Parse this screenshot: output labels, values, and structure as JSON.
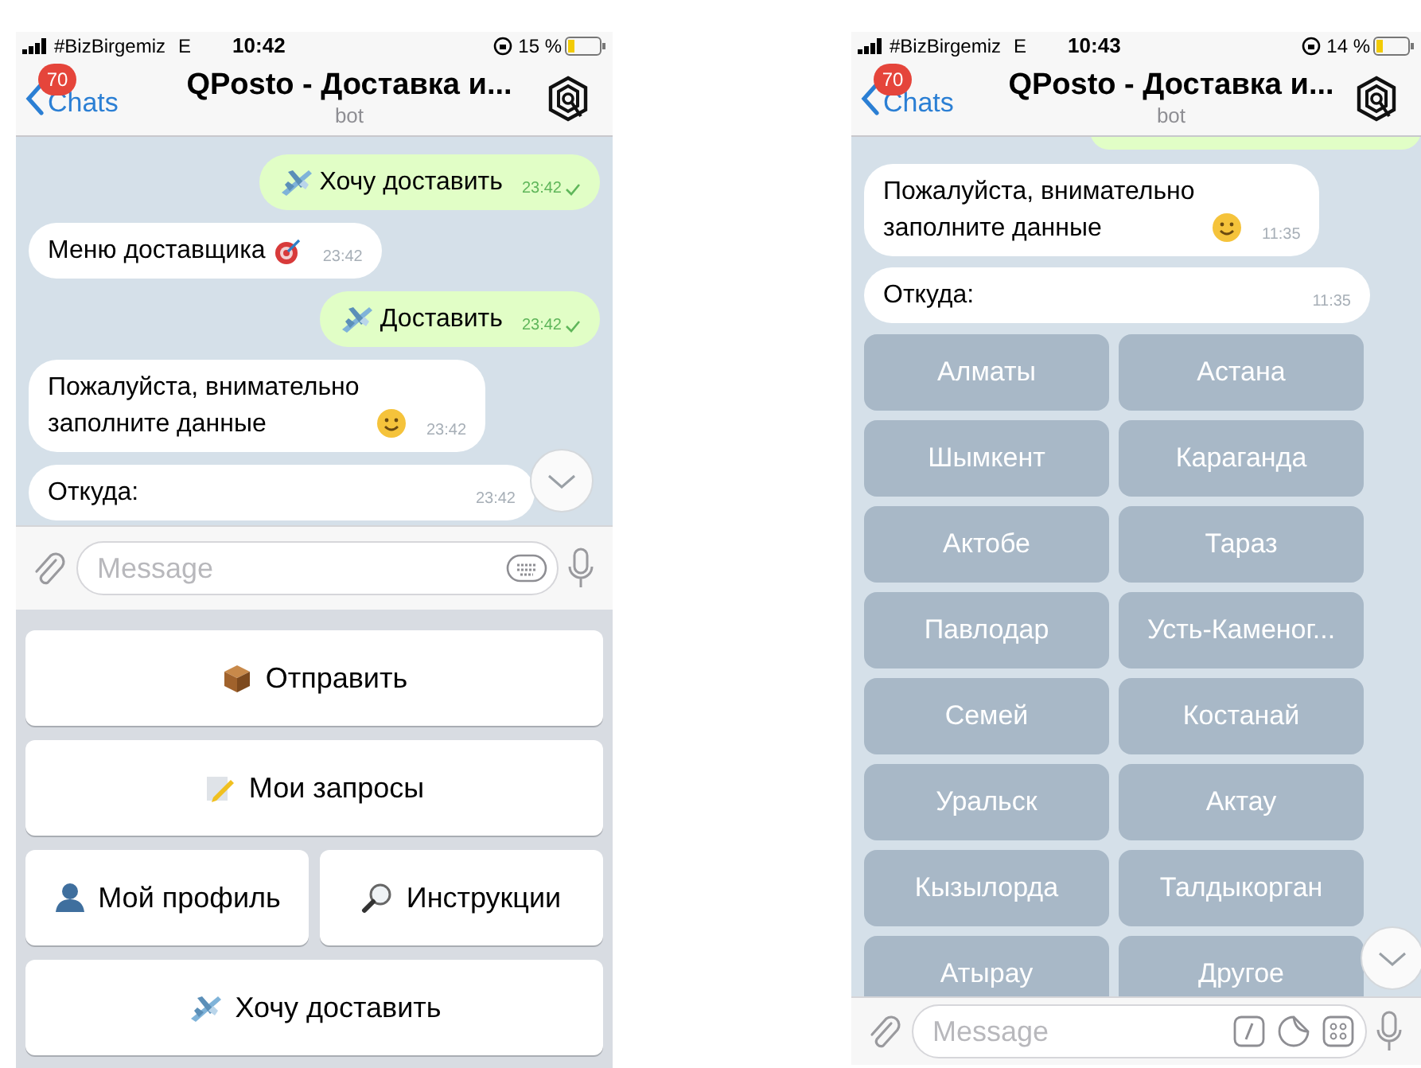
{
  "screens": [
    {
      "status_bar": {
        "carrier": "#BizBirgemiz",
        "network": "E",
        "time": "10:42",
        "battery": "15 %"
      },
      "header": {
        "back": "Chats",
        "badge": "70",
        "title": "QPosto - Доставка и...",
        "subtitle": "bot"
      },
      "messages": [
        {
          "text": "Хочу доставить",
          "time": "23:42",
          "outgoing": true
        },
        {
          "text": "Меню доставщика",
          "time": "23:42",
          "outgoing": false
        },
        {
          "text": "Доставить",
          "time": "23:42",
          "outgoing": true
        },
        {
          "text": "Пожалуйста, внимательно заполните данные",
          "time": "23:42",
          "outgoing": false
        },
        {
          "text": "Откуда:",
          "time": "23:42",
          "outgoing": false
        }
      ],
      "composer": {
        "placeholder": "Message"
      },
      "reply_keyboard": [
        [
          {
            "label": "Отправить"
          }
        ],
        [
          {
            "label": "Мои запросы"
          }
        ],
        [
          {
            "label": "Мой профиль"
          },
          {
            "label": "Инструкции"
          }
        ],
        [
          {
            "label": "Хочу доставить"
          }
        ]
      ]
    },
    {
      "status_bar": {
        "carrier": "#BizBirgemiz",
        "network": "E",
        "time": "10:43",
        "battery": "14 %"
      },
      "header": {
        "back": "Chats",
        "badge": "70",
        "title": "QPosto - Доставка и...",
        "subtitle": "bot"
      },
      "messages": [
        {
          "text": "Пожалуйста, внимательно заполните данные",
          "time": "11:35",
          "outgoing": false
        },
        {
          "text": "Откуда:",
          "time": "11:35",
          "outgoing": false
        }
      ],
      "inline_keyboard": [
        [
          {
            "label": "Алматы"
          },
          {
            "label": "Астана"
          }
        ],
        [
          {
            "label": "Шымкент"
          },
          {
            "label": "Караганда"
          }
        ],
        [
          {
            "label": "Актобе"
          },
          {
            "label": "Тараз"
          }
        ],
        [
          {
            "label": "Павлодар"
          },
          {
            "label": "Усть-Каменог..."
          }
        ],
        [
          {
            "label": "Семей"
          },
          {
            "label": "Костанай"
          }
        ],
        [
          {
            "label": "Уральск"
          },
          {
            "label": "Актау"
          }
        ],
        [
          {
            "label": "Кызылорда"
          },
          {
            "label": "Талдыкорган"
          }
        ],
        [
          {
            "label": "Атырау"
          },
          {
            "label": "Другое"
          }
        ]
      ],
      "composer": {
        "placeholder": "Message"
      }
    }
  ]
}
